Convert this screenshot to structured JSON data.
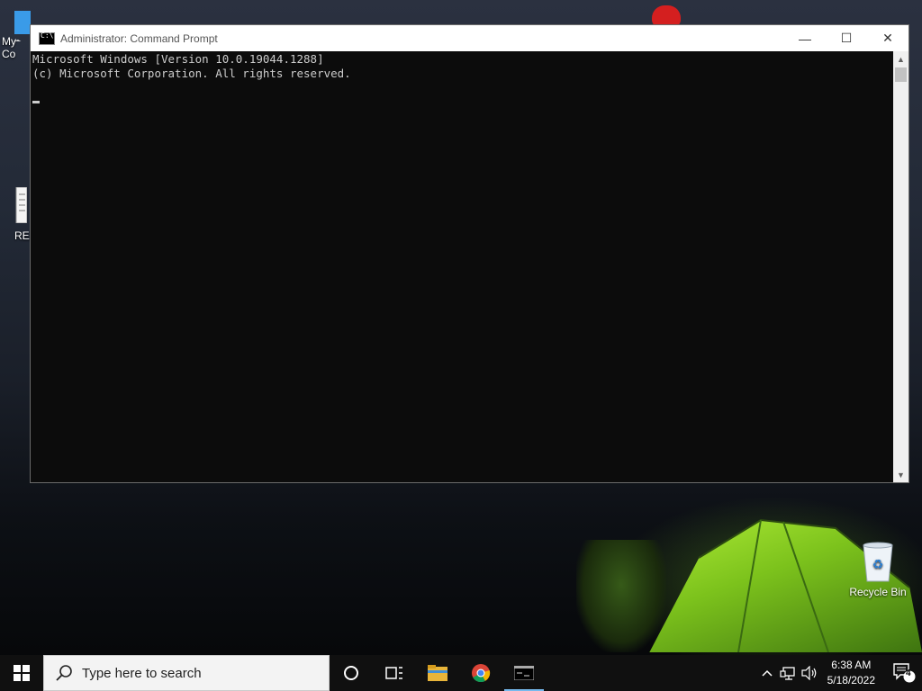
{
  "desktop": {
    "icons": [
      {
        "label": "My Co"
      },
      {
        "label": "REA"
      },
      {
        "label": "Recycle Bin"
      }
    ]
  },
  "window": {
    "title": "Administrator: Command Prompt",
    "minimize_glyph": "—",
    "maximize_glyph": "☐",
    "close_glyph": "✕",
    "console_lines": [
      "Microsoft Windows [Version 10.0.19044.1288]",
      "(c) Microsoft Corporation. All rights reserved."
    ],
    "scroll_up": "▲",
    "scroll_down": "▼"
  },
  "taskbar": {
    "search_placeholder": "Type here to search",
    "time": "6:38 AM",
    "date": "5/18/2022",
    "notifications_count": "4",
    "pinned": [
      "cortana-icon",
      "task-view-icon",
      "file-explorer-icon",
      "chrome-icon",
      "command-prompt-icon"
    ]
  },
  "colors": {
    "console_bg": "#0c0c0c",
    "console_text": "#cccccc",
    "taskbar_bg": "#101010",
    "active_indicator": "#76b9ed"
  }
}
